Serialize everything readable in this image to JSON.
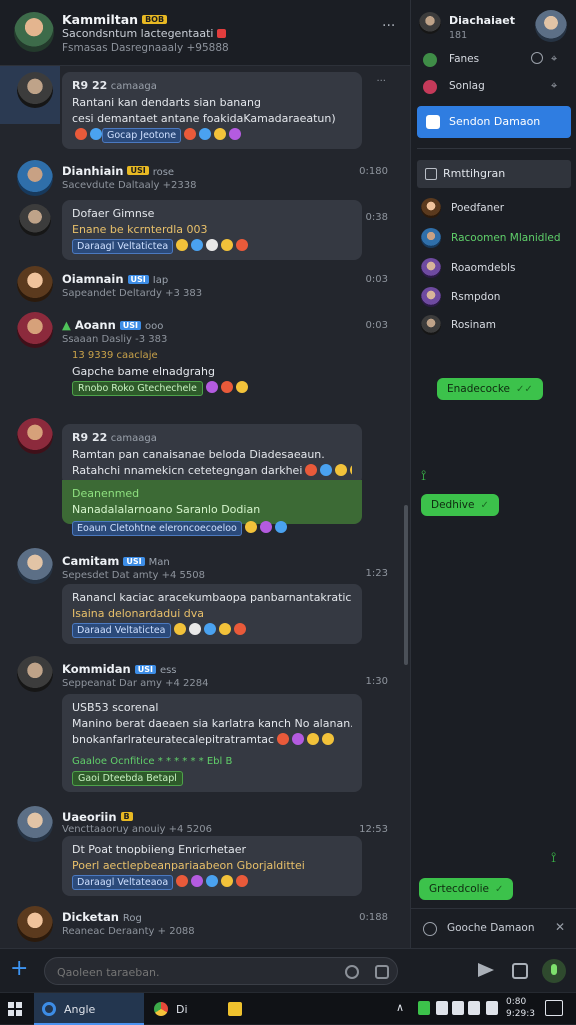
{
  "header": {
    "title": "Kammiltan",
    "badge": "BOB",
    "subtitle": "Sacondsntum lactegentaati",
    "meta": "Fsmasas Dasregnaaaly +95888"
  },
  "messages": [
    {
      "name": "R9 22",
      "role": "camaaga",
      "time": "",
      "lines": [
        "Rantani kan dendarts  sian banang",
        "cesi demantaet antane foakidaKamadaraeatun)"
      ],
      "chip": "Gocap Jeotone",
      "chip_kind": "blue"
    },
    {
      "name": "Dianhiain",
      "role": "rose",
      "badge": "USI",
      "sub": "Sacevdute Daltaaly +2338",
      "time": "0:180",
      "lines": [
        "Dofaer  Gimnse",
        "Enane be kcrnterdla 003"
      ],
      "chip": "Daraagl Veltatictea",
      "chip_kind": "blue"
    },
    {
      "name": "Oiamnain",
      "role": "Iap",
      "badge": "USI",
      "sub": "Sapeandet Deltardy +3 383",
      "time": "0:03"
    },
    {
      "name": "Aoann",
      "role": "ooo",
      "badge": "USI",
      "sub": "Ssaaan Dasliy -3 383",
      "time": "0:03",
      "lines": [
        "13 9339  caaclaje",
        "Gapche bame elnadgrahg"
      ],
      "chip": "Rnobo  Roko  Gtechechele",
      "chip_kind": "green"
    },
    {
      "name": "R9 22",
      "role": "camaaga",
      "time": "",
      "lines": [
        "Ramtan pan  canaisanae  beloda  Diadesaeaun.",
        "Ratahchi  nnamekicn  cetetegngan  darkhei"
      ],
      "highlight": [
        "Deanenmed",
        "Nanadalalarnoano  Saranlo  Dodian"
      ],
      "chip": "Eoaun  Cletohtne  eleroncoecoeloo",
      "chip_kind": "blue"
    },
    {
      "name": "Camitam",
      "role": "Man",
      "badge": "USI",
      "sub": "Sepesdet  Dat amty +4 5508",
      "time": "1:23",
      "lines": [
        "Ranancl kaciac  aracekumbaopa  panbarnantakratic.",
        "Isaina delonardadui dva"
      ],
      "chip": "Daraad Veltatictea",
      "chip_kind": "blue"
    },
    {
      "name": "Kommidan",
      "role": "ess",
      "badge": "USI",
      "sub": "Seppeanat  Dar amy +4 2284",
      "time": "1:30",
      "lines": [
        "USB53  scorenal",
        "Manino  berat daeaen  sia karlatra  kanch No alanan.",
        "bnokanfarlrateuratecalepitratramtac"
      ],
      "green_row": "Gaaloe  Ocnfitice  * * * * * *  Ebl B",
      "chip": "Gaoi  Dteebda  Betapl",
      "chip_kind": "green"
    },
    {
      "name": "Uaeoriin",
      "role": "",
      "badge": "B",
      "sub": "Vencttaaoruy anouiy +4 5206",
      "time": "12:53",
      "lines": [
        "Dt Poat tnopbiieng  Enricrhetaer",
        "Poerl aectlepbeanpariaabeon  Gborjaldittei"
      ],
      "chip": "Daraagl Veltateaoa",
      "chip_kind": "blue"
    },
    {
      "name": "Dicketan",
      "role": "Rog",
      "sub": "Reaneac Deraanty + 2088",
      "time": "0:188"
    }
  ],
  "composer": {
    "placeholder": "Qaoleen taraeban."
  },
  "sidebar": {
    "profile": {
      "name": "Diachaiaet",
      "count": "181"
    },
    "rows": [
      {
        "label": "Fanes"
      },
      {
        "label": "Sonlag"
      }
    ],
    "primary_button": "Sendon Damaon",
    "section": "Rmttihgran",
    "members": [
      {
        "name": "Poedfaner",
        "color": "normal"
      },
      {
        "name": "Racoomen Mlanidled",
        "color": "green"
      },
      {
        "name": "Roaomdebls",
        "color": "normal"
      },
      {
        "name": "Rsmpdon",
        "color": "normal"
      },
      {
        "name": "Rosinam",
        "color": "normal"
      }
    ],
    "green_bubbles": [
      "Enadecocke",
      "Dedhive",
      "Grtecdcolie"
    ],
    "bottom": "Gooche Damaon"
  },
  "taskbar": {
    "apps": [
      "Angle",
      "Di"
    ],
    "clock": [
      "0:80",
      "9:29:3"
    ]
  }
}
